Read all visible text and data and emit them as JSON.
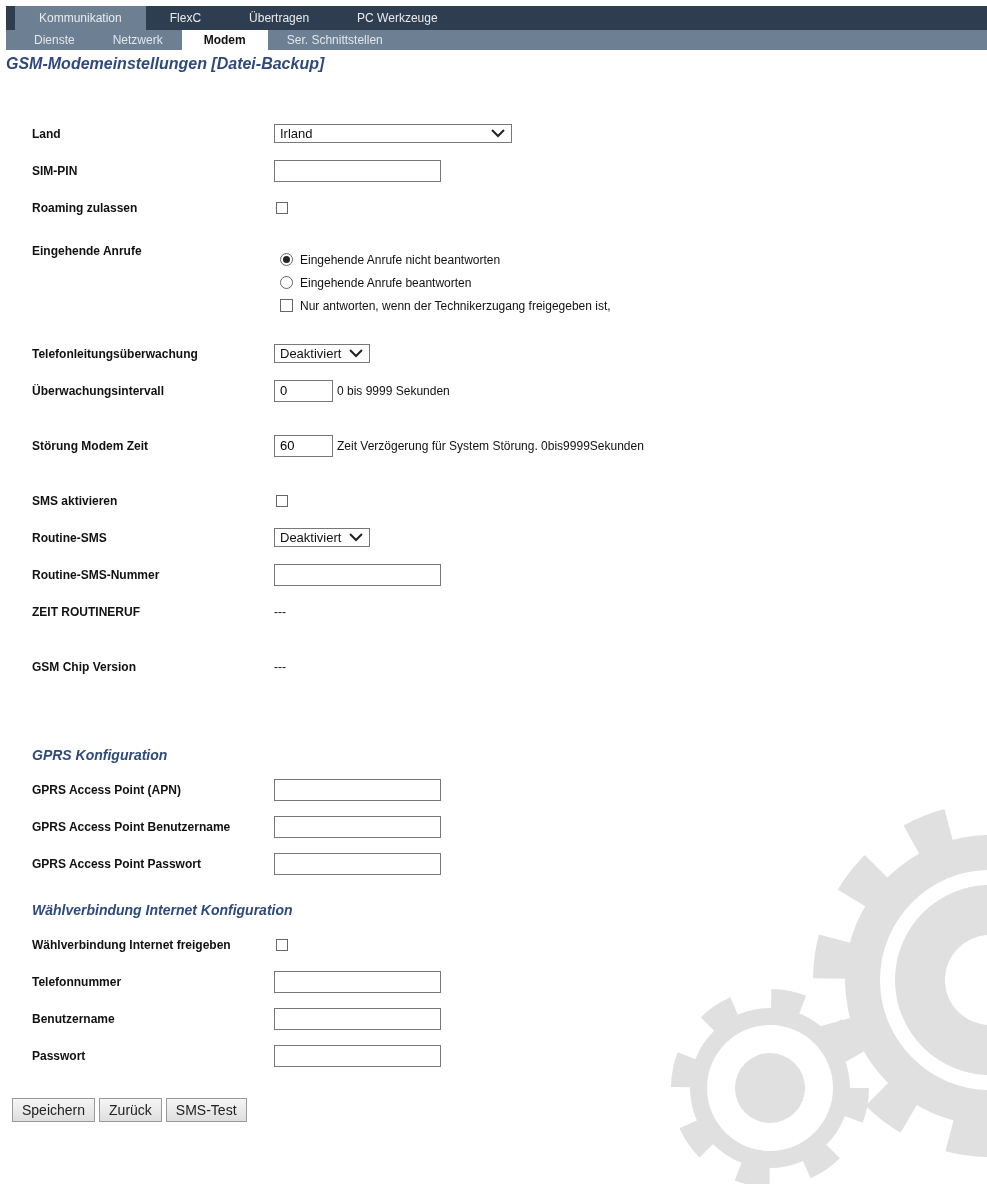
{
  "top_tabs": [
    {
      "label": "Kommunikation",
      "selected": true
    },
    {
      "label": "FlexC",
      "selected": false
    },
    {
      "label": "Übertragen",
      "selected": false
    },
    {
      "label": "PC Werkzeuge",
      "selected": false
    }
  ],
  "sub_tabs": [
    {
      "label": "Dienste",
      "selected": false
    },
    {
      "label": "Netzwerk",
      "selected": false
    },
    {
      "label": "Modem",
      "selected": true
    },
    {
      "label": "Ser. Schnittstellen",
      "selected": false
    }
  ],
  "title": "GSM-Modemeinstellungen [Datei-Backup]",
  "groups": [
    {
      "rows": [
        {
          "kind": "select",
          "label": "Land",
          "value": "Irland"
        },
        {
          "kind": "text",
          "label": "SIM-PIN"
        },
        {
          "kind": "checkbox",
          "label": "Roaming zulassen",
          "checked": false
        }
      ]
    },
    {
      "rows": [
        {
          "kind": "options",
          "label": "Eingehende Anrufe",
          "options": [
            {
              "kind": "radio",
              "label": "Eingehende Anrufe nicht beantworten",
              "selected": true
            },
            {
              "kind": "radio",
              "label": "Eingehende Anrufe beantworten",
              "selected": false
            },
            {
              "kind": "checkbox",
              "label": "Nur antworten, wenn der Technikerzugang freigegeben ist,",
              "checked": false
            }
          ]
        }
      ]
    },
    {
      "rows": [
        {
          "kind": "select",
          "label": "Telefonleitungsüberwachung",
          "value": "Deaktiviert"
        },
        {
          "kind": "number",
          "label": "Überwachungsintervall",
          "value": "0",
          "hint": "0 bis 9999 Sekunden"
        }
      ]
    },
    {
      "rows": [
        {
          "kind": "number",
          "label": "Störung Modem Zeit",
          "value": "60",
          "hint": "Zeit Verzögerung für System Störung. 0bis9999Sekunden"
        }
      ]
    },
    {
      "rows": [
        {
          "kind": "checkbox",
          "label": "SMS aktivieren",
          "checked": false
        },
        {
          "kind": "select",
          "label": "Routine-SMS",
          "value": "Deaktiviert"
        },
        {
          "kind": "text",
          "label": "Routine-SMS-Nummer"
        },
        {
          "kind": "static",
          "label": "ZEIT ROUTINERUF",
          "value": "---"
        }
      ]
    },
    {
      "rows": [
        {
          "kind": "static",
          "label": "GSM Chip Version",
          "value": "---"
        }
      ]
    },
    {
      "heading": "GPRS Konfiguration",
      "rows": [
        {
          "kind": "text",
          "label": "GPRS Access Point (APN)"
        },
        {
          "kind": "text",
          "label": "GPRS Access Point Benutzername"
        },
        {
          "kind": "text",
          "label": "GPRS Access Point Passwort"
        }
      ]
    },
    {
      "heading": "Wählverbindung Internet Konfiguration",
      "rows": [
        {
          "kind": "checkbox",
          "label": "Wählverbindung Internet freigeben",
          "checked": false
        },
        {
          "kind": "text",
          "label": "Telefonnummer"
        },
        {
          "kind": "text",
          "label": "Benutzername"
        },
        {
          "kind": "text",
          "label": "Passwort"
        }
      ]
    }
  ],
  "buttons": [
    "Speichern",
    "Zurück",
    "SMS-Test"
  ]
}
